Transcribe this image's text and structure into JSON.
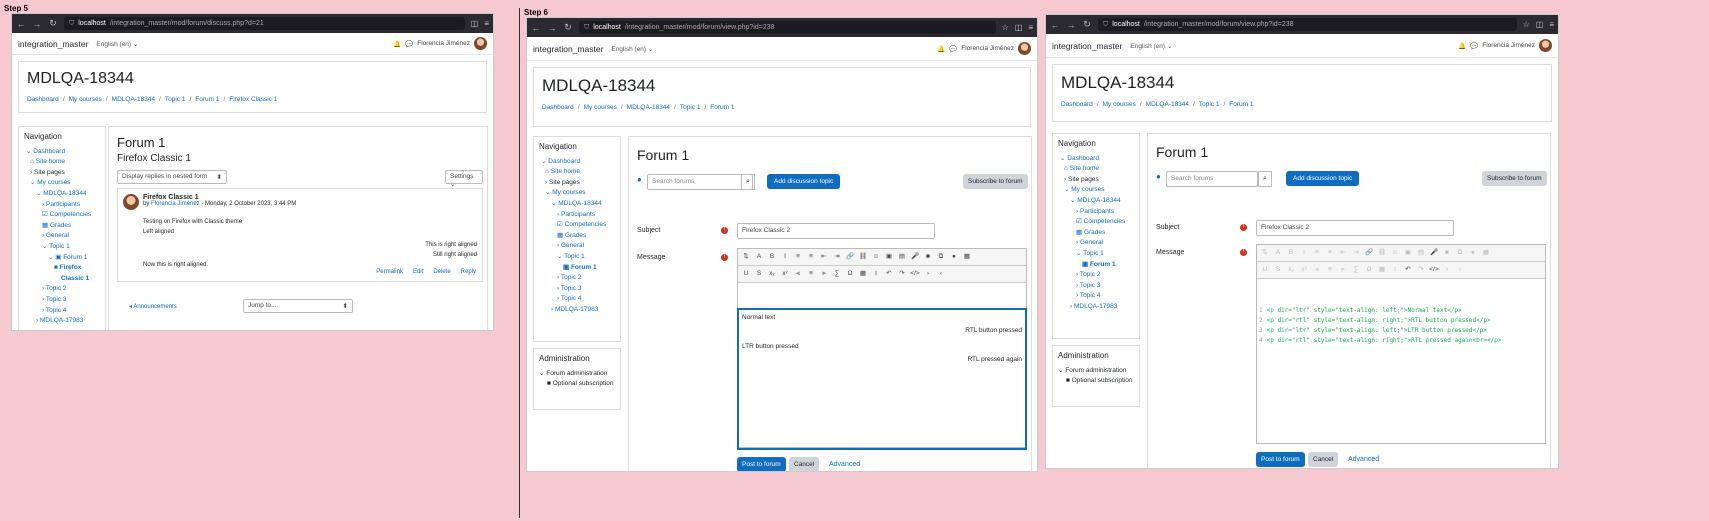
{
  "steps": {
    "s5": "Step 5",
    "s6": "Step 6"
  },
  "p1": {
    "url_host": "localhost",
    "url_path": "/integration_master/mod/forum/discuss.php?d=21",
    "site": "integration_master",
    "lang": "English (en) ⌄",
    "user": "Florencia Jiménez",
    "course": "MDLQA-18344",
    "crumbs": [
      "Dashboard",
      "My courses",
      "MDLQA-18344",
      "Topic 1",
      "Forum 1",
      "Firefox Classic 1"
    ],
    "nav_title": "Navigation",
    "nav": [
      "Dashboard",
      "Site home",
      "Site pages",
      "My courses",
      "MDLQA-18344",
      "Participants",
      "Competencies",
      "Grades",
      "General",
      "Topic 1",
      "Forum 1",
      "Firefox",
      "Classic 1",
      "Topic 2",
      "Topic 3",
      "Topic 4",
      "MDLQA-17983"
    ],
    "forum": "Forum 1",
    "discussion": "Firefox Classic 1",
    "display_select": "Display replies in nested form",
    "settings": "Settings ⌄",
    "post_title": "Firefox Classic 1",
    "post_by": "by",
    "post_author": "Florencia Jiménez",
    "post_date": " - Monday, 2 October 2023, 3:44 PM",
    "line1": "Testing on Firefox with Classic theme",
    "line2": "Left aligned",
    "line3": "This is right aligned",
    "line4": "Still right aligned",
    "line5": "Now this is right aligned.",
    "actions": [
      "Permalink",
      "Edit",
      "Delete",
      "Reply"
    ],
    "prev": "◂ Announcements",
    "jump": "Jump to..."
  },
  "p2": {
    "url_host": "localhost",
    "url_path": "/integration_master/mod/forum/view.php?id=238",
    "site": "integration_master",
    "lang": "English (en) ⌄",
    "user": "Florencia Jiménez",
    "course": "MDLQA-18344",
    "crumbs": [
      "Dashboard",
      "My courses",
      "MDLQA-18344",
      "Topic 1",
      "Forum 1"
    ],
    "nav_title": "Navigation",
    "nav": [
      "Dashboard",
      "Site home",
      "Site pages",
      "My courses",
      "MDLQA-18344",
      "Participants",
      "Competencies",
      "Grades",
      "General",
      "Topic 1",
      "Forum 1",
      "Topic 2",
      "Topic 3",
      "Topic 4",
      "MDLQA-17983"
    ],
    "admin_title": "Administration",
    "admin1": "Forum administration",
    "admin2": "Optional subscription",
    "forum": "Forum 1",
    "search_ph": "Search forums",
    "add": "Add discussion topic",
    "subscribe": "Subscribe to forum",
    "subject_lbl": "Subject",
    "subject": "Firefox Classic 2",
    "message_lbl": "Message",
    "m1": "Normal text",
    "m2": "RTL button pressed",
    "m3": "LTR button pressed",
    "m4": "RTL pressed again",
    "post": "Post to forum",
    "cancel": "Cancel",
    "advanced": "Advanced"
  },
  "p3": {
    "url_host": "localhost",
    "url_path": "/integration_master/mod/forum/view.php?id=238",
    "site": "integration_master",
    "lang": "English (en) ⌄",
    "user": "Florencia Jiménez",
    "course": "MDLQA-18344",
    "crumbs": [
      "Dashboard",
      "My courses",
      "MDLQA-18344",
      "Topic 1",
      "Forum 1"
    ],
    "nav_title": "Navigation",
    "nav": [
      "Dashboard",
      "Site home",
      "Site pages",
      "My courses",
      "MDLQA-18344",
      "Participants",
      "Competencies",
      "Grades",
      "General",
      "Topic 1",
      "Forum 1",
      "Topic 2",
      "Topic 3",
      "Topic 4",
      "MDLQA-17983"
    ],
    "admin_title": "Administration",
    "admin1": "Forum administration",
    "admin2": "Optional subscription",
    "forum": "Forum 1",
    "search_ph": "Search forums",
    "add": "Add discussion topic",
    "subscribe": "Subscribe to forum",
    "subject_lbl": "Subject",
    "subject": "Firefox Classic 2",
    "message_lbl": "Message",
    "code": [
      "<p dir=\"ltr\" style=\"text-align: left;\">Normal text</p>",
      "<p dir=\"rtl\" style=\"text-align: right;\">RTL button pressed</p>",
      "<p dir=\"ltr\" style=\"text-align: left;\">LTR button pressed</p>",
      "<p dir=\"rtl\" style=\"text-align: right;\">RTL pressed again<br></p>"
    ],
    "post": "Post to forum",
    "cancel": "Cancel",
    "advanced": "Advanced"
  },
  "colors": {
    "link": "#0f6cbf",
    "bg": "#f6c8d0",
    "chrome": "#2b2a33"
  }
}
